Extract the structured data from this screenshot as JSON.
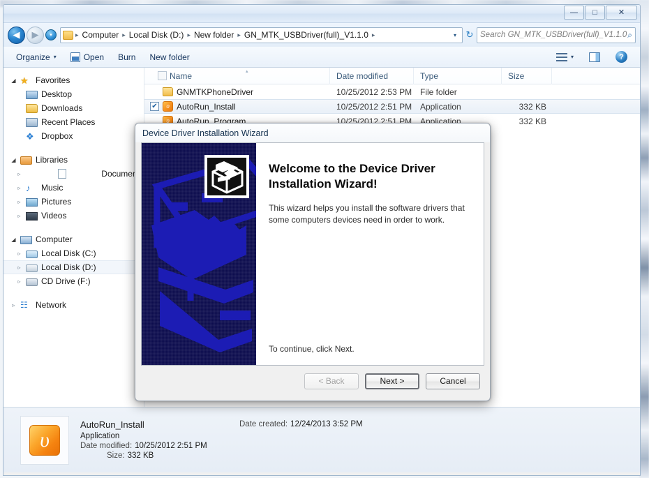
{
  "window": {
    "controls": {
      "minimize": "—",
      "maximize": "□",
      "close": "✕"
    }
  },
  "nav": {
    "back_icon": "◀",
    "forward_icon": "▶",
    "history_icon": "▾",
    "separator": "▸",
    "dropdown": "▾",
    "refresh_icon": "↻",
    "breadcrumbs": [
      "Computer",
      "Local Disk (D:)",
      "New folder",
      "GN_MTK_USBDriver(full)_V1.1.0"
    ]
  },
  "search": {
    "placeholder": "Search GN_MTK_USBDriver(full)_V1.1.0",
    "value": "",
    "icon": "⌕"
  },
  "toolbar": {
    "organize_label": "Organize",
    "organize_caret": "▾",
    "open_label": "Open",
    "burn_label": "Burn",
    "new_folder_label": "New folder",
    "views_caret": "▾",
    "help_label": "?"
  },
  "sidebar": {
    "groups": [
      {
        "header": {
          "label": "Favorites",
          "tri": "◢",
          "icon": "star-icon",
          "glyph": "★"
        },
        "items": [
          {
            "label": "Desktop",
            "icon": "desktop-icon"
          },
          {
            "label": "Downloads",
            "icon": "downloads-icon"
          },
          {
            "label": "Recent Places",
            "icon": "recent-places-icon"
          },
          {
            "label": "Dropbox",
            "icon": "dropbox-icon",
            "glyph": "❖"
          }
        ]
      },
      {
        "header": {
          "label": "Libraries",
          "tri": "◢",
          "icon": "libraries-icon"
        },
        "items": [
          {
            "label": "Documents",
            "icon": "documents-icon",
            "tri": "▹"
          },
          {
            "label": "Music",
            "icon": "music-icon",
            "tri": "▹",
            "glyph": "♪"
          },
          {
            "label": "Pictures",
            "icon": "pictures-icon",
            "tri": "▹"
          },
          {
            "label": "Videos",
            "icon": "videos-icon",
            "tri": "▹"
          }
        ]
      },
      {
        "header": {
          "label": "Computer",
          "tri": "◢",
          "icon": "computer-icon"
        },
        "items": [
          {
            "label": "Local Disk (C:)",
            "icon": "drive-c-icon",
            "tri": "▹"
          },
          {
            "label": "Local Disk (D:)",
            "icon": "drive-d-icon",
            "tri": "▹",
            "selected": true
          },
          {
            "label": "CD Drive (F:)",
            "icon": "cd-drive-icon",
            "tri": "▹"
          }
        ]
      },
      {
        "header": {
          "label": "Network",
          "tri": "▹",
          "icon": "network-icon",
          "glyph": "☷"
        },
        "items": []
      }
    ]
  },
  "filelist": {
    "columns": [
      "Name",
      "Date modified",
      "Type",
      "Size"
    ],
    "sort_indicator": "▴",
    "rows": [
      {
        "name": "GNMTKPhoneDriver",
        "date_modified": "10/25/2012 2:53 PM",
        "type": "File folder",
        "size": "",
        "icon": "folder-icon",
        "checked": false,
        "selected": false
      },
      {
        "name": "AutoRun_Install",
        "date_modified": "10/25/2012 2:51 PM",
        "type": "Application",
        "size": "332 KB",
        "icon": "application-icon",
        "glyph": "υ",
        "checked": true,
        "selected": true
      },
      {
        "name": "AutoRun_Program",
        "date_modified": "10/25/2012 2:51 PM",
        "type": "Application",
        "size": "332 KB",
        "icon": "application-icon",
        "glyph": "υ",
        "checked": false,
        "selected": false
      }
    ],
    "checkmark": "✔"
  },
  "details": {
    "title": "AutoRun_Install",
    "type": "Application",
    "date_modified_key": "Date modified:",
    "date_modified_value": "10/25/2012 2:51 PM",
    "size_key": "Size:",
    "size_value": "332 KB",
    "date_created_key": "Date created:",
    "date_created_value": "12/24/2013 3:52 PM",
    "icon_glyph": "υ"
  },
  "dialog": {
    "title": "Device Driver Installation Wizard",
    "heading": "Welcome to the Device Driver Installation Wizard!",
    "paragraph": "This wizard helps you install the software drivers that some computers devices need in order to work.",
    "continue_text": "To continue, click Next.",
    "buttons": {
      "back": "< Back",
      "next": "Next >",
      "cancel": "Cancel"
    }
  },
  "colors": {
    "banner_bg": "#0d0d4e",
    "banner_art": "#1c1cb4",
    "accent": "#2a7fc4",
    "app_icon": "#f58310",
    "folder": "#f1bd4c"
  }
}
